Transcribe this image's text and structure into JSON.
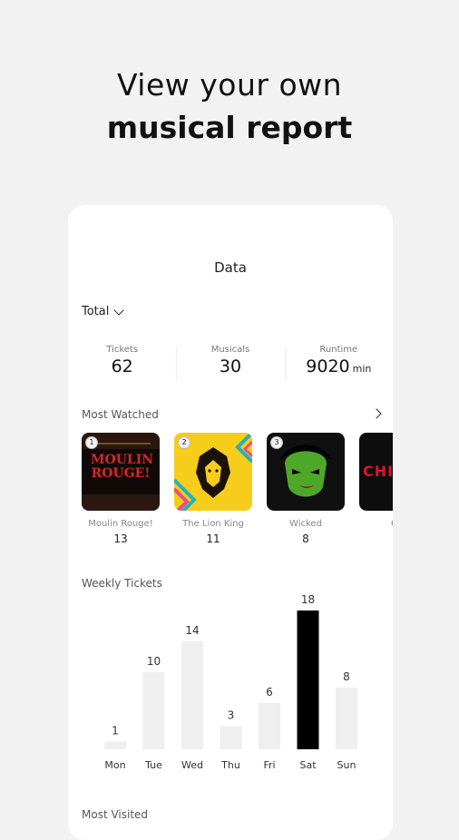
{
  "headline": {
    "line1": "View your own",
    "line2": "musical report"
  },
  "card": {
    "title": "Data",
    "filter": "Total",
    "stats": [
      {
        "label": "Tickets",
        "value": "62",
        "unit": ""
      },
      {
        "label": "Musicals",
        "value": "30",
        "unit": ""
      },
      {
        "label": "Runtime",
        "value": "9020",
        "unit": "min"
      }
    ],
    "most_watched": {
      "label": "Most Watched",
      "items": [
        {
          "rank": "1",
          "title": "Moulin Rouge!",
          "count": "13",
          "poster_text": "MOULIN ROUGE!"
        },
        {
          "rank": "2",
          "title": "The Lion King",
          "count": "11",
          "poster_text": ""
        },
        {
          "rank": "3",
          "title": "Wicked",
          "count": "8",
          "poster_text": ""
        },
        {
          "rank": "",
          "title": "Chi",
          "count": "",
          "poster_text": "CHIC"
        }
      ]
    },
    "weekly": {
      "label": "Weekly Tickets"
    },
    "most_visited": {
      "label": "Most Visited"
    }
  },
  "chart_data": {
    "type": "bar",
    "categories": [
      "Mon",
      "Tue",
      "Wed",
      "Thu",
      "Fri",
      "Sat",
      "Sun"
    ],
    "values": [
      1,
      10,
      14,
      3,
      6,
      18,
      8
    ],
    "highlight_index": 5,
    "colors": {
      "bar": "#efefef",
      "highlight": "#000000",
      "label": "#333333"
    }
  },
  "colors": {
    "background": "#f2f2f2",
    "card": "#ffffff",
    "text": "#111111",
    "accent": "#000000"
  }
}
